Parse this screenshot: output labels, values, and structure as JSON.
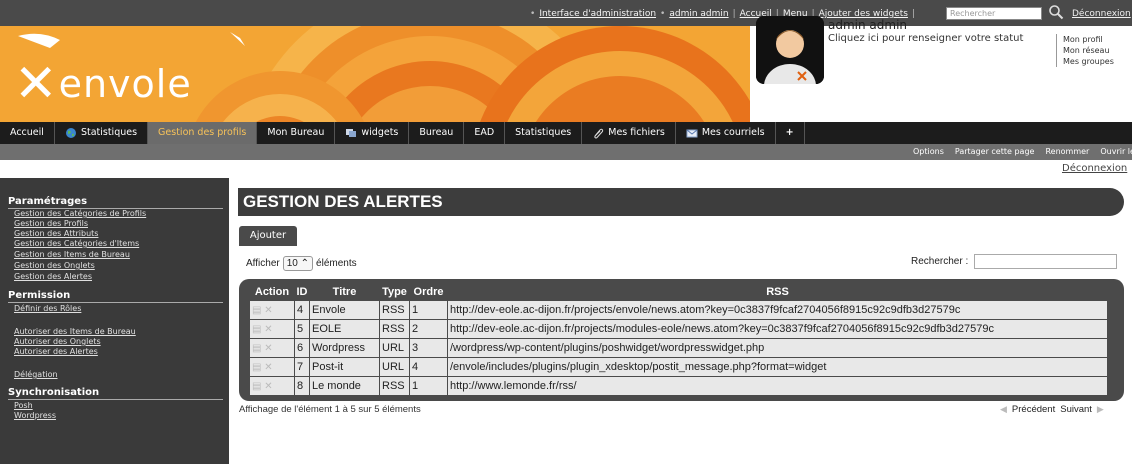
{
  "topbar": {
    "links": [
      "Interface d'administration",
      "admin admin",
      "Accueil",
      "Menu",
      "Ajouter des widgets"
    ],
    "search_placeholder": "Rechercher",
    "logout": "Déconnexion"
  },
  "banner": {
    "logo_text": "envole",
    "user_name": "admin admin",
    "user_status": "Cliquez ici pour renseigner votre statut",
    "side_links": [
      "Mon profil",
      "Mon réseau",
      "Mes groupes"
    ]
  },
  "nav": {
    "tabs": [
      {
        "label": "Accueil",
        "icon": ""
      },
      {
        "label": "Statistiques",
        "icon": "globe-icon"
      },
      {
        "label": "Gestion des profils",
        "icon": "",
        "active": true
      },
      {
        "label": "Mon Bureau",
        "icon": ""
      },
      {
        "label": "widgets",
        "icon": "widgets-icon"
      },
      {
        "label": "Bureau",
        "icon": ""
      },
      {
        "label": "EAD",
        "icon": ""
      },
      {
        "label": "Statistiques",
        "icon": ""
      },
      {
        "label": "Mes fichiers",
        "icon": "paperclip-icon"
      },
      {
        "label": "Mes courriels",
        "icon": "mail-icon"
      },
      {
        "label": "+",
        "icon": ""
      }
    ]
  },
  "subbar": {
    "actions": [
      "Options",
      "Partager cette page",
      "Renommer",
      "Ouvrir le site"
    ],
    "deconnexion": "Déconnexion"
  },
  "sidebar": {
    "sections": [
      {
        "title": "Paramétrages",
        "items": [
          "Gestion des Catégories de Profils",
          "Gestion des Profils",
          "Gestion des Attributs",
          "Gestion des Catégories d'Items",
          "Gestion des Items de Bureau",
          "Gestion des Onglets",
          "Gestion des Alertes"
        ]
      },
      {
        "title": "Permission",
        "items": [
          "Définir des Rôles",
          "Autoriser des Items de Bureau",
          "Autoriser des Onglets",
          "Autoriser des Alertes",
          "Délégation"
        ]
      },
      {
        "title": "Synchronisation",
        "items": [
          "Posh",
          "Wordpress"
        ]
      }
    ]
  },
  "main": {
    "title": "GESTION DES ALERTES",
    "add_button": "Ajouter",
    "show_prefix": "Afficher",
    "show_value": "10",
    "show_suffix": "éléments",
    "search_label": "Rechercher :",
    "columns": [
      "Action",
      "ID",
      "Titre",
      "Type",
      "Ordre",
      "RSS"
    ],
    "rows": [
      {
        "id": "4",
        "titre": "Envole",
        "type": "RSS",
        "ordre": "1",
        "rss": "http://dev-eole.ac-dijon.fr/projects/envole/news.atom?key=0c3837f9fcaf2704056f8915c92c9dfb3d27579c"
      },
      {
        "id": "5",
        "titre": "EOLE",
        "type": "RSS",
        "ordre": "2",
        "rss": "http://dev-eole.ac-dijon.fr/projects/modules-eole/news.atom?key=0c3837f9fcaf2704056f8915c92c9dfb3d27579c"
      },
      {
        "id": "6",
        "titre": "Wordpress",
        "type": "URL",
        "ordre": "3",
        "rss": "/wordpress/wp-content/plugins/poshwidget/wordpresswidget.php"
      },
      {
        "id": "7",
        "titre": "Post-it",
        "type": "URL",
        "ordre": "4",
        "rss": "/envole/includes/plugins/plugin_xdesktop/postit_message.php?format=widget"
      },
      {
        "id": "8",
        "titre": "Le monde",
        "type": "RSS",
        "ordre": "1",
        "rss": "http://www.lemonde.fr/rss/"
      }
    ],
    "info": "Affichage de l'élément 1 à 5 sur 5 éléments",
    "prev": "Précédent",
    "next": "Suivant"
  }
}
